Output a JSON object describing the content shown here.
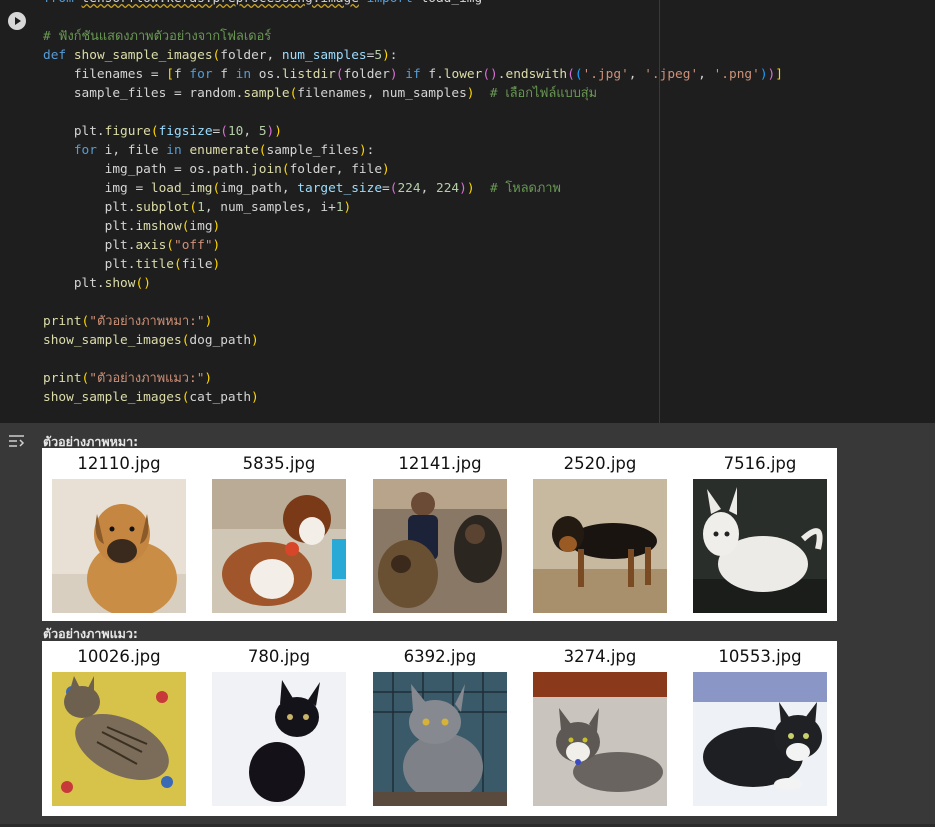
{
  "code_cell": {
    "run_button_label": "Run cell",
    "lines": [
      "from tensorflow.keras.preprocessing.image import load_img",
      "",
      "# ฟังก์ชันแสดงภาพตัวอย่างจากโฟลเดอร์",
      "def show_sample_images(folder, num_samples=5):",
      "    filenames = [f for f in os.listdir(folder) if f.lower().endswith(('.jpg', '.jpeg', '.png'))]",
      "    sample_files = random.sample(filenames, num_samples)  # เลือกไฟล์แบบสุ่ม",
      "",
      "    plt.figure(figsize=(10, 5))",
      "    for i, file in enumerate(sample_files):",
      "        img_path = os.path.join(folder, file)",
      "        img = load_img(img_path, target_size=(224, 224))  # โหลดภาพ",
      "        plt.subplot(1, num_samples, i+1)",
      "        plt.imshow(img)",
      "        plt.axis(\"off\")",
      "        plt.title(file)",
      "    plt.show()",
      "",
      "print(\"ตัวอย่างภาพหมา:\")",
      "show_sample_images(dog_path)",
      "",
      "print(\"ตัวอย่างภาพแมว:\")",
      "show_sample_images(cat_path)"
    ]
  },
  "output": {
    "icon": "output-settings-icon",
    "dogs": {
      "label": "ตัวอย่างภาพหมา:",
      "images": [
        {
          "title": "12110.jpg",
          "subject": "tan dog sitting"
        },
        {
          "title": "5835.jpg",
          "subject": "brown and white dog with toy"
        },
        {
          "title": "12141.jpg",
          "subject": "person with two dogs"
        },
        {
          "title": "2520.jpg",
          "subject": "black and tan dog standing"
        },
        {
          "title": "7516.jpg",
          "subject": "white dog"
        }
      ]
    },
    "cats": {
      "label": "ตัวอย่างภาพแมว:",
      "images": [
        {
          "title": "10026.jpg",
          "subject": "tabby cat lying on blanket"
        },
        {
          "title": "780.jpg",
          "subject": "black kitten"
        },
        {
          "title": "6392.jpg",
          "subject": "gray cat sitting"
        },
        {
          "title": "3274.jpg",
          "subject": "gray and white cat"
        },
        {
          "title": "10553.jpg",
          "subject": "black and white cat"
        }
      ]
    }
  },
  "colors": {
    "code_bg": "#1e1e1e",
    "output_bg": "#383838",
    "keyword": "#569cd6",
    "function": "#dcdcaa",
    "string": "#ce9178",
    "comment": "#6a9955"
  }
}
